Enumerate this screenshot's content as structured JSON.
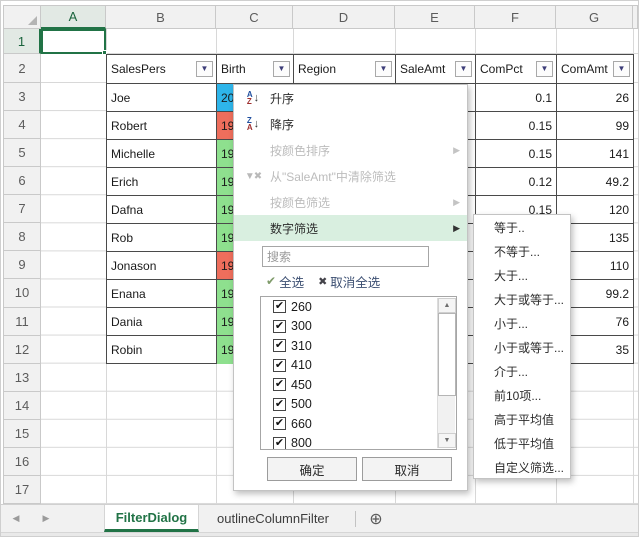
{
  "sheet": {
    "col_headers": [
      "A",
      "B",
      "C",
      "D",
      "E",
      "F",
      "G"
    ],
    "row_headers": [
      "1",
      "2",
      "3",
      "4",
      "5",
      "6",
      "7",
      "8",
      "9",
      "10",
      "11",
      "12",
      "13",
      "14",
      "15",
      "16",
      "17"
    ]
  },
  "table": {
    "headers": [
      "SalesPers",
      "Birth",
      "Region",
      "SaleAmt",
      "ComPct",
      "ComAmt"
    ],
    "rows": [
      {
        "name": "Joe",
        "birth": "20",
        "birth_bg": "#2eb5ea",
        "pct": "0.1",
        "amt": "26"
      },
      {
        "name": "Robert",
        "birth": "19",
        "birth_bg": "#ee6e5c",
        "pct": "0.15",
        "amt": "99"
      },
      {
        "name": "Michelle",
        "birth": "19",
        "birth_bg": "#8ee08e",
        "pct": "0.15",
        "amt": "141"
      },
      {
        "name": "Erich",
        "birth": "19",
        "birth_bg": "#8ee08e",
        "pct": "0.12",
        "amt": "49.2"
      },
      {
        "name": "Dafna",
        "birth": "19",
        "birth_bg": "#8ee08e",
        "pct": "0.15",
        "amt": "120"
      },
      {
        "name": "Rob",
        "birth": "19",
        "birth_bg": "#8ee08e",
        "pct": "",
        "amt": "135"
      },
      {
        "name": "Jonason",
        "birth": "19",
        "birth_bg": "#ee6e5c",
        "pct": "",
        "amt": "110"
      },
      {
        "name": "Enana",
        "birth": "19",
        "birth_bg": "#8ee08e",
        "pct": "",
        "amt": "99.2"
      },
      {
        "name": "Dania",
        "birth": "19",
        "birth_bg": "#8ee08e",
        "pct": "",
        "amt": "76"
      },
      {
        "name": "Robin",
        "birth": "19",
        "birth_bg": "#8ee08e",
        "pct": "",
        "amt": "35"
      }
    ]
  },
  "filter_menu": {
    "sort_asc": "升序",
    "sort_desc": "降序",
    "sort_by_color": "按颜色排序",
    "clear_filter": "从\"SaleAmt\"中清除筛选",
    "filter_by_color": "按颜色筛选",
    "number_filters": "数字筛选",
    "search_placeholder": "搜索",
    "select_all": "全选",
    "deselect_all": "取消全选",
    "values": [
      {
        "label": "260",
        "checked": true
      },
      {
        "label": "300",
        "checked": true
      },
      {
        "label": "310",
        "checked": true
      },
      {
        "label": "410",
        "checked": true
      },
      {
        "label": "450",
        "checked": true
      },
      {
        "label": "500",
        "checked": true
      },
      {
        "label": "660",
        "checked": true
      },
      {
        "label": "800",
        "checked": true
      }
    ],
    "ok_label": "确定",
    "cancel_label": "取消"
  },
  "submenu": {
    "items": [
      "等于..",
      "不等于...",
      "大于...",
      "大于或等于...",
      "小于...",
      "小于或等于...",
      "介于...",
      "前10项...",
      "高于平均值",
      "低于平均值",
      "自定义筛选..."
    ]
  },
  "tabbar": {
    "active_tab": "FilterDialog",
    "other_tab": "outlineColumnFilter"
  },
  "colors": {
    "accent_green": "#217346",
    "menu_highlight": "#d9efe0",
    "cell_blue": "#2eb5ea",
    "cell_salmon": "#ee6e5c",
    "cell_green": "#8ee08e"
  }
}
